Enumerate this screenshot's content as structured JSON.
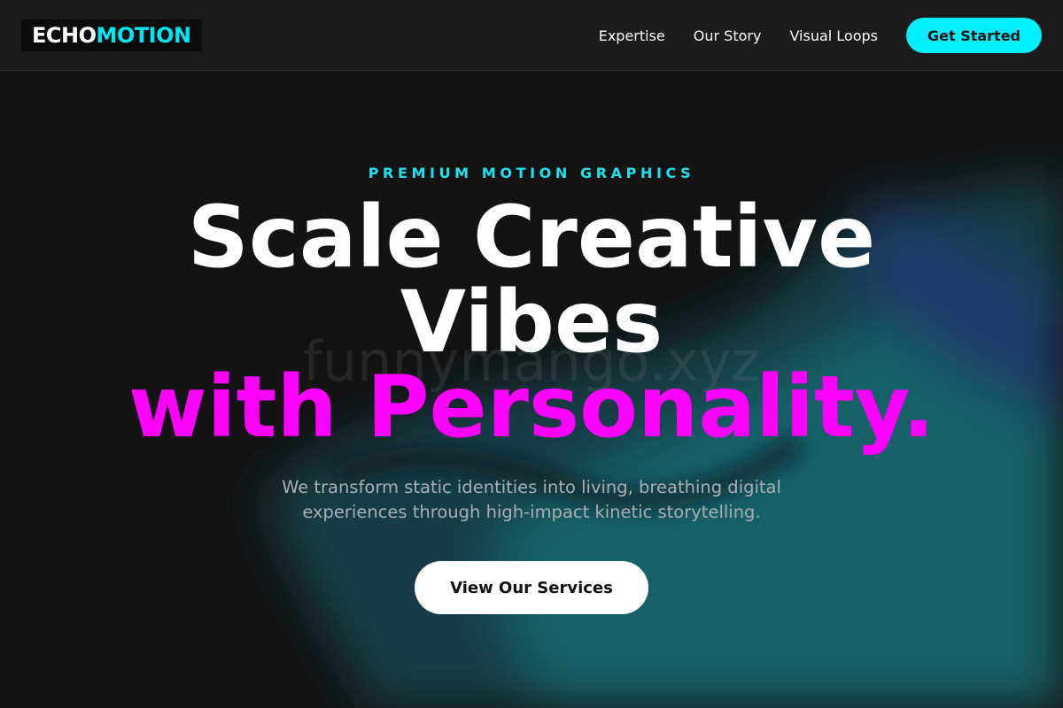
{
  "header": {
    "logo_part1": "ECHO",
    "logo_part2": "MOTION",
    "nav": [
      "Expertise",
      "Our Story",
      "Visual Loops"
    ],
    "cta_label": "Get Started"
  },
  "hero": {
    "eyebrow": "PREMIUM MOTION GRAPHICS",
    "headline_line1": "Scale Creative",
    "headline_line2": "Vibes",
    "headline_line3": "with Personality.",
    "watermark": "funnymango.xyz",
    "subtitle_line1": "We transform static identities into living, breathing digital",
    "subtitle_line2": "experiences through high-impact kinetic storytelling.",
    "button_label": "View Our Services"
  },
  "colors": {
    "accent_cyan": "#00f0ff",
    "accent_magenta": "#ff00ff",
    "background": "#131313"
  }
}
